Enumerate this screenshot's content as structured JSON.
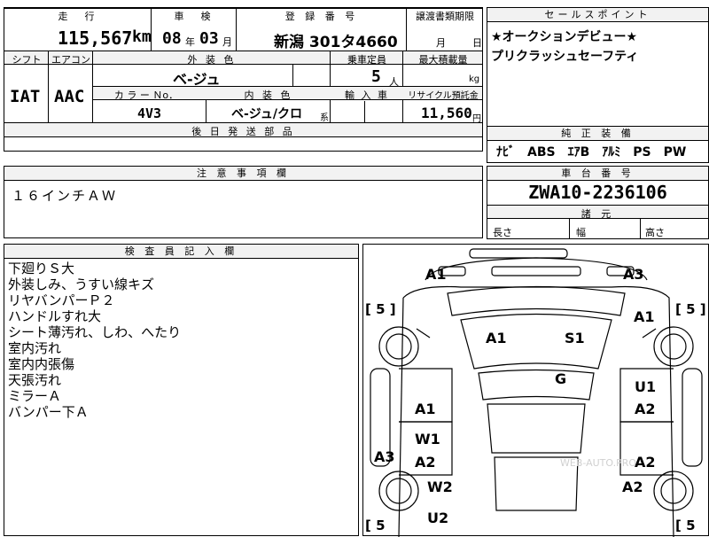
{
  "top": {
    "hdr_mileage": "走　行",
    "hdr_inspection": "車　検",
    "hdr_reg": "登 録 番 号",
    "hdr_transfer": "譲渡書類期限",
    "hdr_salespoint": "セールスポイント",
    "mileage_value": "115,567",
    "mileage_unit": "km",
    "insp_year": "08",
    "insp_year_unit": "年",
    "insp_month": "03",
    "insp_month_unit": "月",
    "reg_number": "新潟 301タ4660",
    "transfer_month": "月",
    "transfer_day": "日"
  },
  "spec": {
    "hdr_shift": "シフト",
    "hdr_ac": "エアコン",
    "hdr_ext_color": "外 装 色",
    "hdr_capacity": "乗車定員",
    "hdr_load": "最大積載量",
    "shift": "IAT",
    "ac": "AAC",
    "ext_color": "ベ-ジュ",
    "capacity": "5",
    "capacity_unit": "人",
    "load_unit": "kg",
    "hdr_color_no": "カ ラ ー Ｎo．",
    "hdr_interior": "内 装 色",
    "hdr_import": "輸 入 車",
    "hdr_recycle": "リサイクル預託金",
    "color_no": "4V3",
    "interior": "ベ-ジュ/クロ",
    "interior_suffix": "系",
    "recycle": "11,560",
    "recycle_unit": "円",
    "hdr_later_parts": "後 日 発 送 部 品"
  },
  "sales_points": [
    "★オークションデビュー★",
    "プリクラッシュセーフティ"
  ],
  "equipment": {
    "hdr": "純 正 装 備",
    "items": "ﾅﾋﾞ　ABS　ｴｱB　ｱﾙﾐ　PS　PW"
  },
  "notes": {
    "hdr": "注 意 事 項 欄",
    "text": "１６インチＡＷ"
  },
  "chassis": {
    "hdr": "車 台 番 号",
    "number": "ZWA10-2236106",
    "hdr_dim": "諸 元",
    "length": "長さ",
    "width": "幅",
    "height": "高さ"
  },
  "inspector": {
    "hdr": "検 査 員 記 入 欄",
    "lines": [
      "下廻りＳ大",
      "外装しみ、うすい線キズ",
      "リヤバンパーＰ２",
      "ハンドルすれ大",
      "シート薄汚れ、しわ、へたり",
      "室内汚れ",
      "室内内張傷",
      "天張汚れ",
      "ミラーＡ",
      "バンパー下Ａ"
    ]
  },
  "diagram": {
    "tire_left_top": "[ 5 ]",
    "tire_right_top": "[ 5 ]",
    "tire_left_bottom": "[ 5",
    "tire_right_bottom": "[ 5",
    "marks": [
      "A1",
      "A3",
      "A1",
      "A1",
      "S1",
      "G",
      "U1",
      "A1",
      "A2",
      "W1",
      "A2",
      "A3",
      "A2",
      "W2",
      "A2",
      "U2"
    ],
    "watermark": "WEB-AUTO.PRO"
  }
}
